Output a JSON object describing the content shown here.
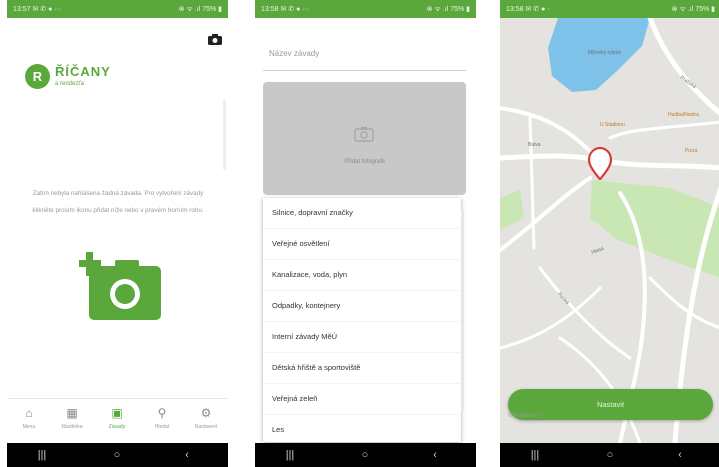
{
  "colors": {
    "brand": "#5aa83c",
    "nav": "#000000",
    "photo_box": "#c8c8c8",
    "water": "#7ec2ea",
    "park": "#c9e6b5",
    "pin": "#d93a3a"
  },
  "screen1": {
    "status_left": "13:57 ✉ ✆ ● ···",
    "status_right": "⊗ ᯤ .ıl 75% ▮",
    "logo_letter": "R",
    "logo_title": "ŘÍČANY",
    "logo_subtitle": "a rendezťa",
    "intro_text": "Zatím nebyla nahlášena žádná závada. Pro vytvoření závady klikněte prosím ikonu přidat níže nebo v pravém horním rohu.",
    "tabs": [
      {
        "label": "Menu",
        "icon": "home-icon"
      },
      {
        "label": "Nástěnka",
        "icon": "board-icon"
      },
      {
        "label": "Závady",
        "icon": "camera-icon"
      },
      {
        "label": "Hledat",
        "icon": "search-icon"
      },
      {
        "label": "Nastavení",
        "icon": "gear-icon"
      }
    ]
  },
  "screen2": {
    "status_left": "13:58 ✉ ✆ ● ···",
    "status_right": "⊗ ᯤ .ıl 75% ▮",
    "name_placeholder": "Název závady",
    "photo_label": "Přidat fotografii",
    "categories": [
      "Silnice, dopravní značky",
      "Veřejné osvětlení",
      "Kanalizace, voda, plyn",
      "Odpadky, kontejnery",
      "Interní závady MěÚ",
      "Dětská hřiště a sportoviště",
      "Veřejná zeleň",
      "Les"
    ]
  },
  "screen3": {
    "status_left": "13:58 ✉ ✆ ● ·",
    "status_right": "⊗ ᯤ .ıl 75% ▮",
    "map_labels": [
      "Mlýnský rybník",
      "Pražská",
      "Hudba/Nostra",
      "U Stadionu",
      "Pizza",
      "Bulva",
      "Ryska",
      "Hlasá"
    ],
    "set_button": "Nastavit",
    "map_attribution": "©mapbox ⓘ"
  }
}
